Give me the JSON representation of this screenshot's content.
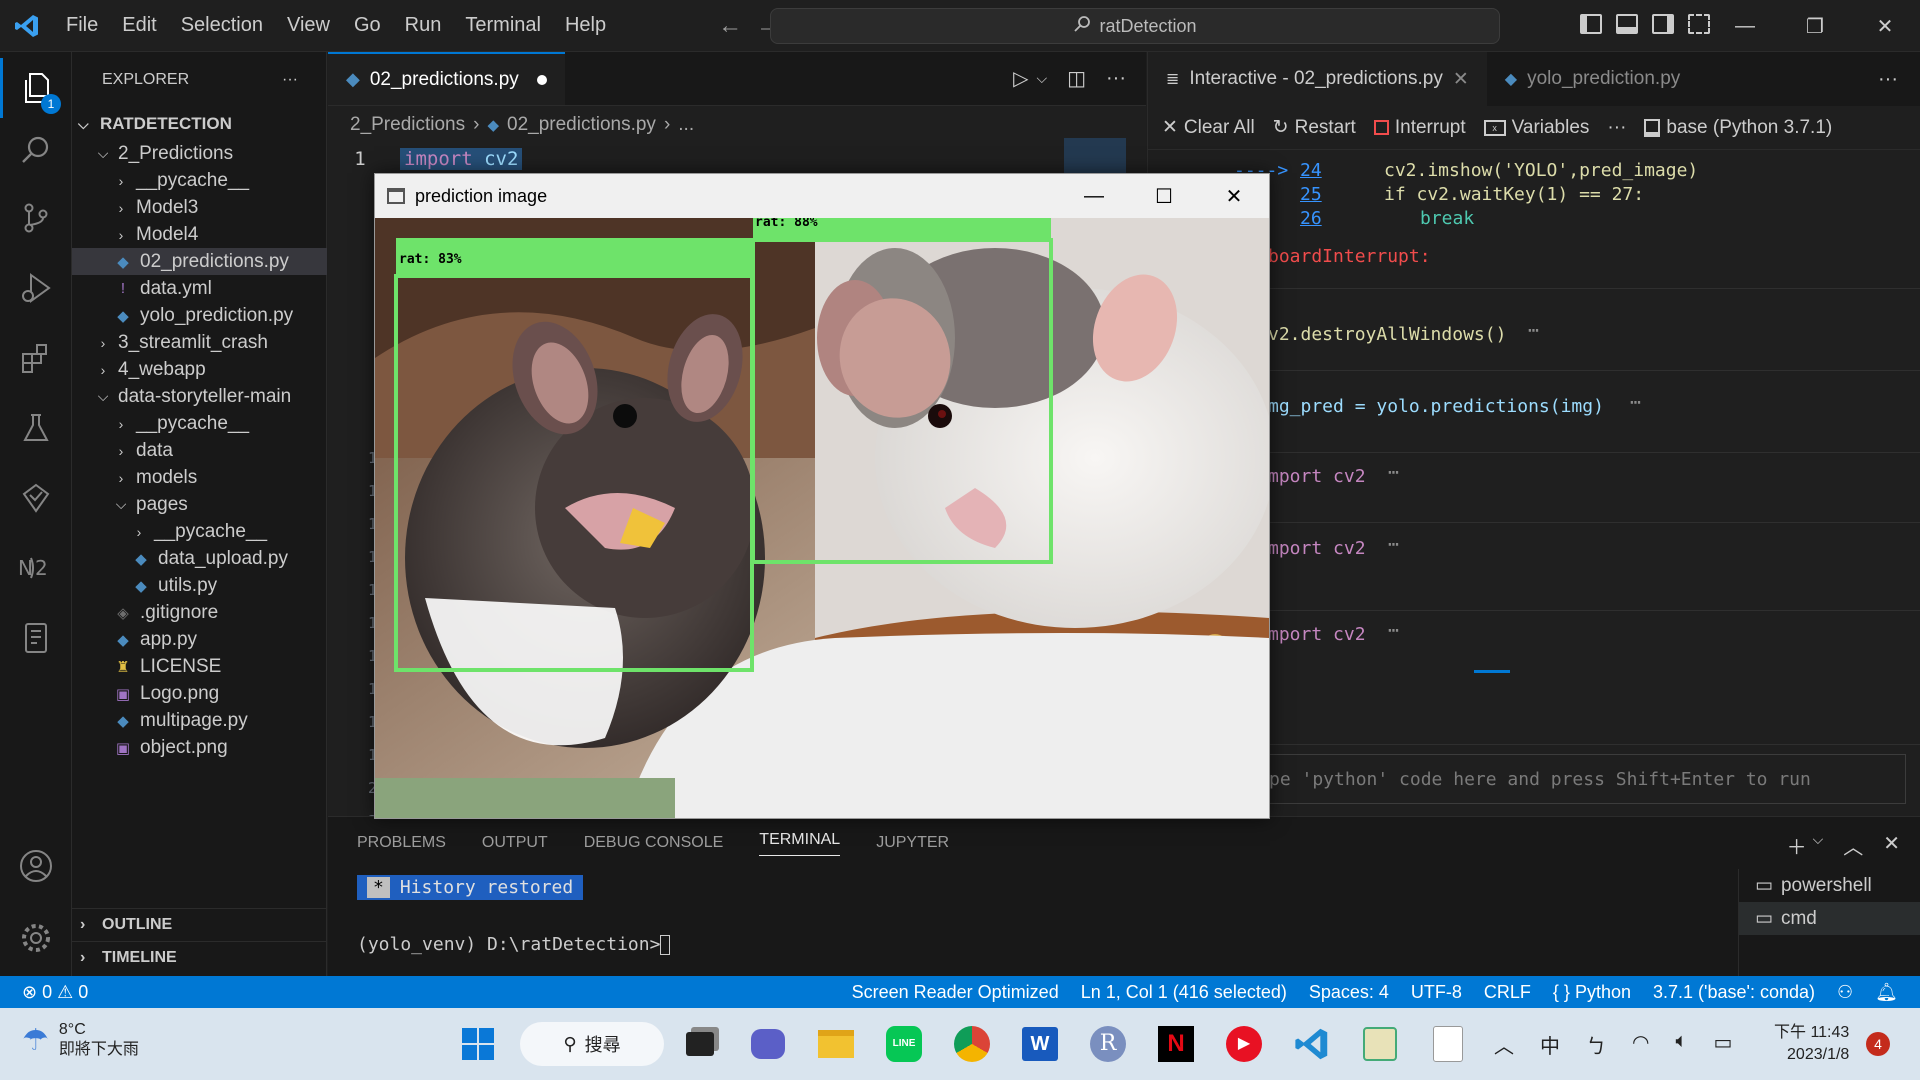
{
  "titlebar": {
    "menu": [
      "File",
      "Edit",
      "Selection",
      "View",
      "Go",
      "Run",
      "Terminal",
      "Help"
    ],
    "search_text": "ratDetection"
  },
  "explorer": {
    "title": "EXPLORER",
    "root": "RATDETECTION",
    "items": [
      {
        "label": "2_Predictions",
        "type": "folder-open",
        "depth": 1
      },
      {
        "label": "__pycache__",
        "type": "folder",
        "depth": 2
      },
      {
        "label": "Model3",
        "type": "folder",
        "depth": 2
      },
      {
        "label": "Model4",
        "type": "folder",
        "depth": 2
      },
      {
        "label": "02_predictions.py",
        "type": "py",
        "depth": 2,
        "selected": true
      },
      {
        "label": "data.yml",
        "type": "yml",
        "depth": 2
      },
      {
        "label": "yolo_prediction.py",
        "type": "py",
        "depth": 2
      },
      {
        "label": "3_streamlit_crash",
        "type": "folder",
        "depth": 1
      },
      {
        "label": "4_webapp",
        "type": "folder",
        "depth": 1
      },
      {
        "label": "data-storyteller-main",
        "type": "folder-open",
        "depth": 1
      },
      {
        "label": "__pycache__",
        "type": "folder",
        "depth": 2
      },
      {
        "label": "data",
        "type": "folder",
        "depth": 2
      },
      {
        "label": "models",
        "type": "folder",
        "depth": 2
      },
      {
        "label": "pages",
        "type": "folder-open",
        "depth": 2
      },
      {
        "label": "__pycache__",
        "type": "folder",
        "depth": 3
      },
      {
        "label": "data_upload.py",
        "type": "py",
        "depth": 3
      },
      {
        "label": "utils.py",
        "type": "py",
        "depth": 3
      },
      {
        "label": ".gitignore",
        "type": "git",
        "depth": 2
      },
      {
        "label": "app.py",
        "type": "py",
        "depth": 2
      },
      {
        "label": "LICENSE",
        "type": "license",
        "depth": 2
      },
      {
        "label": "Logo.png",
        "type": "img",
        "depth": 2
      },
      {
        "label": "multipage.py",
        "type": "py",
        "depth": 2
      },
      {
        "label": "object.png",
        "type": "img",
        "depth": 2
      }
    ],
    "outline": "OUTLINE",
    "timeline": "TIMELINE"
  },
  "editor": {
    "tab_label": "02_predictions.py",
    "breadcrumb": [
      "2_Predictions",
      "02_predictions.py",
      "..."
    ],
    "line_number": "1",
    "code_kw": "import",
    "code_mod": "cv2"
  },
  "interactive": {
    "tab_active": "Interactive - 02_predictions.py",
    "tab_other": "yolo_prediction.py",
    "toolbar": {
      "clear": "Clear All",
      "restart": "Restart",
      "interrupt": "Interrupt",
      "variables": "Variables",
      "kernel": "base (Python 3.7.1)"
    },
    "arrow": "---->",
    "lines": [
      {
        "num": "24",
        "code": "cv2.imshow('YOLO',pred_image)"
      },
      {
        "num": "25",
        "code": "if cv2.waitKey(1) == 27:"
      },
      {
        "num": "26",
        "code": "break"
      }
    ],
    "frag_interrupt": "boardInterrupt:",
    "frag_destroy": "v2.destroyAllWindows()",
    "frag_pred": "mg_pred = yolo.predictions(img)",
    "frag_import": [
      "mport cv2",
      "mport cv2",
      "mport cv2"
    ],
    "input_placeholder": "pe 'python' code here and press Shift+Enter to run"
  },
  "panel": {
    "tabs": [
      "PROBLEMS",
      "OUTPUT",
      "DEBUG CONSOLE",
      "TERMINAL",
      "JUPYTER"
    ],
    "active_tab": "TERMINAL",
    "history": "History restored",
    "prompt": "(yolo_venv) D:\\ratDetection>",
    "terminals": [
      "powershell",
      "cmd"
    ]
  },
  "prediction_window": {
    "title": "prediction image",
    "labels": [
      "rat: 83%",
      "rat: 88%"
    ]
  },
  "statusbar": {
    "errors": "0",
    "warnings": "0",
    "reader": "Screen Reader Optimized",
    "position": "Ln 1, Col 1 (416 selected)",
    "spaces": "Spaces: 4",
    "encoding": "UTF-8",
    "eol": "CRLF",
    "language": "Python",
    "interpreter": "3.7.1 ('base': conda)"
  },
  "taskbar": {
    "temp": "8°C",
    "weather": "即將下大雨",
    "search": "搜尋",
    "ime": "中",
    "time": "下午 11:43",
    "date": "2023/1/8",
    "notifications": "4"
  }
}
